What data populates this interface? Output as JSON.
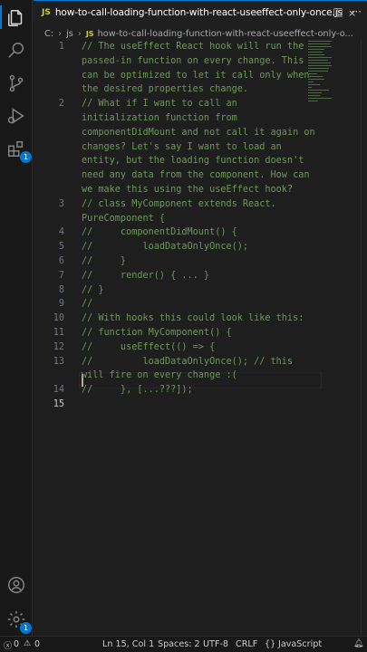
{
  "tab": {
    "file_type": "JS",
    "title": "how-to-call-loading-function-with-react-useeffect-only-once.js",
    "close": "×",
    "split": "◫",
    "more": "···"
  },
  "breadcrumb": {
    "drive": "C:",
    "folder": "js",
    "file_type": "JS",
    "file": "how-to-call-loading-function-with-react-useeffect-only-o..."
  },
  "editor": {
    "lines": [
      {
        "n": "1",
        "rows": [
          "// The useEffect React hook will run the",
          "passed-in function on every change. This",
          "can be optimized to let it call only when",
          "the desired properties change."
        ]
      },
      {
        "n": "2",
        "rows": [
          "// What if I want to call an",
          "initialization function from",
          "componentDidMount and not call it again on",
          "changes? Let's say I want to load an",
          "entity, but the loading function doesn't",
          "need any data from the component. How can",
          "we make this using the useEffect hook?"
        ]
      },
      {
        "n": "3",
        "rows": [
          "// class MyComponent extends React.",
          "PureComponent {"
        ]
      },
      {
        "n": "4",
        "rows": [
          "//     componentDidMount() {"
        ]
      },
      {
        "n": "5",
        "rows": [
          "//         loadDataOnlyOnce();"
        ]
      },
      {
        "n": "6",
        "rows": [
          "//     }"
        ]
      },
      {
        "n": "7",
        "rows": [
          "//     render() { ... }"
        ]
      },
      {
        "n": "8",
        "rows": [
          "// }"
        ]
      },
      {
        "n": "9",
        "rows": [
          "//"
        ]
      },
      {
        "n": "10",
        "rows": [
          "// With hooks this could look like this:"
        ]
      },
      {
        "n": "11",
        "rows": [
          "// function MyComponent() {"
        ]
      },
      {
        "n": "12",
        "rows": [
          "//     useEffect(() => {"
        ]
      },
      {
        "n": "13",
        "rows": [
          "//         loadDataOnlyOnce(); // this",
          "will fire on every change :("
        ]
      },
      {
        "n": "14",
        "rows": [
          "//     }, [...???]);"
        ]
      },
      {
        "n": "15",
        "rows": [
          ""
        ]
      }
    ],
    "current_line": "15"
  },
  "status": {
    "errors": "0",
    "warnings": "0",
    "position": "Ln 15, Col 1",
    "spaces": "Spaces: 2",
    "encoding": "UTF-8",
    "eol": "CRLF",
    "braces": "{}",
    "language": "JavaScript"
  },
  "badges": {
    "extensions": "1",
    "manage": "1"
  },
  "colors": {
    "comment": "#6a9955",
    "accent": "#0078d4",
    "js_icon": "#cbcb41"
  }
}
